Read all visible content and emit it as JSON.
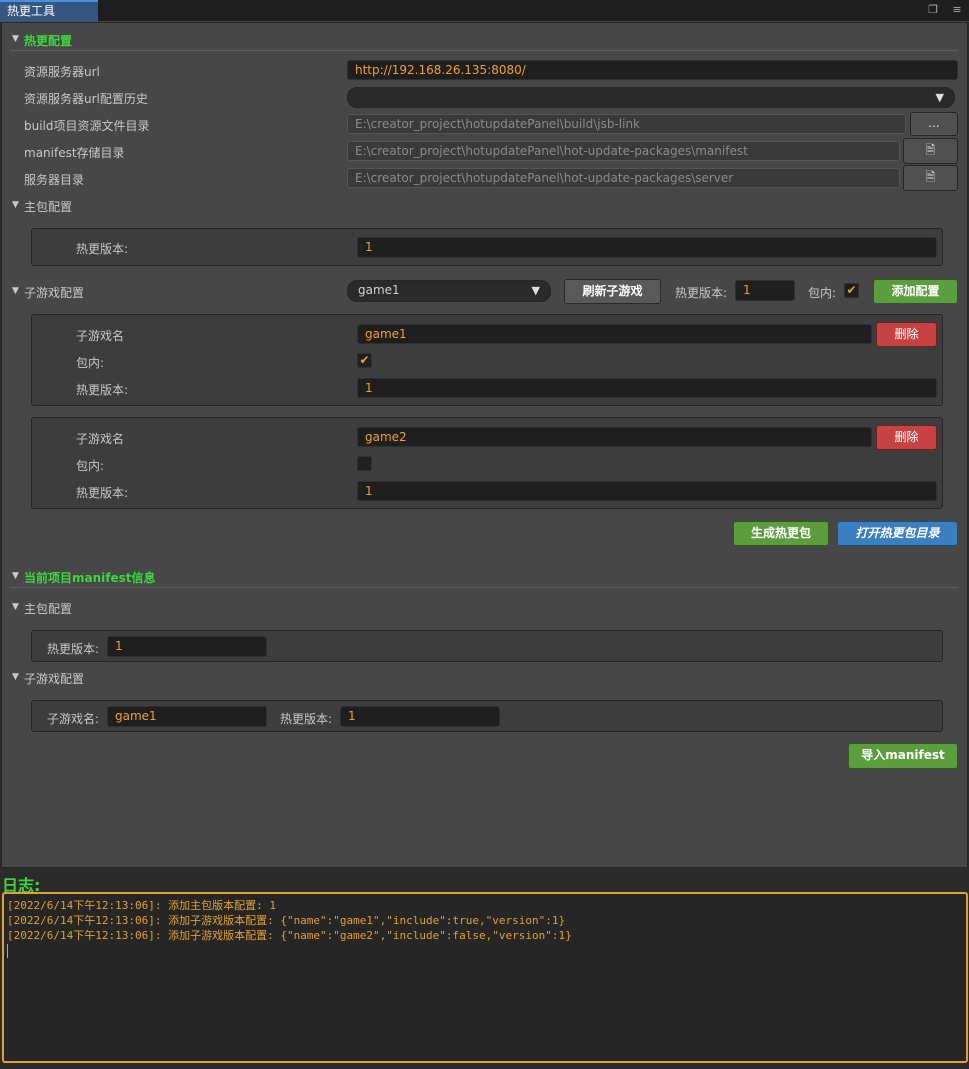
{
  "tab": {
    "title": "热更工具"
  },
  "hot_config": {
    "title": "热更配置",
    "rows": [
      {
        "label": "资源服务器url",
        "value": "http://192.168.26.135:8080/"
      },
      {
        "label": "资源服务器url配置历史",
        "value": ""
      },
      {
        "label": "build项目资源文件目录",
        "value": "E:\\creator_project\\hotupdatePanel\\build\\jsb-link",
        "button": "..."
      },
      {
        "label": "manifest存储目录",
        "value": "E:\\creator_project\\hotupdatePanel\\hot-update-packages\\manifest"
      },
      {
        "label": "服务器目录",
        "value": "E:\\creator_project\\hotupdatePanel\\hot-update-packages\\server"
      }
    ],
    "main_package": {
      "title": "主包配置",
      "version_label": "热更版本:",
      "version": "1"
    },
    "subgame": {
      "title": "子游戏配置",
      "select_value": "game1",
      "refresh_label": "刷新子游戏",
      "version_label": "热更版本:",
      "version": "1",
      "include_label": "包内:",
      "include": true,
      "add_label": "添加配置",
      "items": [
        {
          "name_label": "子游戏名",
          "name": "game1",
          "delete_label": "删除",
          "include_label": "包内:",
          "include": true,
          "version_label": "热更版本:",
          "version": "1"
        },
        {
          "name_label": "子游戏名",
          "name": "game2",
          "delete_label": "删除",
          "include_label": "包内:",
          "include": false,
          "version_label": "热更版本:",
          "version": "1"
        }
      ]
    },
    "generate_label": "生成热更包",
    "open_dir_label": "打开热更包目录"
  },
  "manifest_info": {
    "title": "当前项目manifest信息",
    "main_package": {
      "title": "主包配置",
      "version_label": "热更版本:",
      "version": "1"
    },
    "subgame": {
      "title": "子游戏配置",
      "name_label": "子游戏名:",
      "name": "game1",
      "version_label": "热更版本:",
      "version": "1"
    },
    "import_label": "导入manifest"
  },
  "log": {
    "title": "日志:",
    "lines": [
      "[2022/6/14下午12:13:06]: 添加主包版本配置: 1",
      "[2022/6/14下午12:13:06]: 添加子游戏版本配置: {\"name\":\"game1\",\"include\":true,\"version\":1}",
      "[2022/6/14下午12:13:06]: 添加子游戏版本配置: {\"name\":\"game2\",\"include\":false,\"version\":1}"
    ]
  },
  "colors": {
    "accent_green": "#3dd63d",
    "value_orange": "#f0a030",
    "panel": "#474747"
  }
}
